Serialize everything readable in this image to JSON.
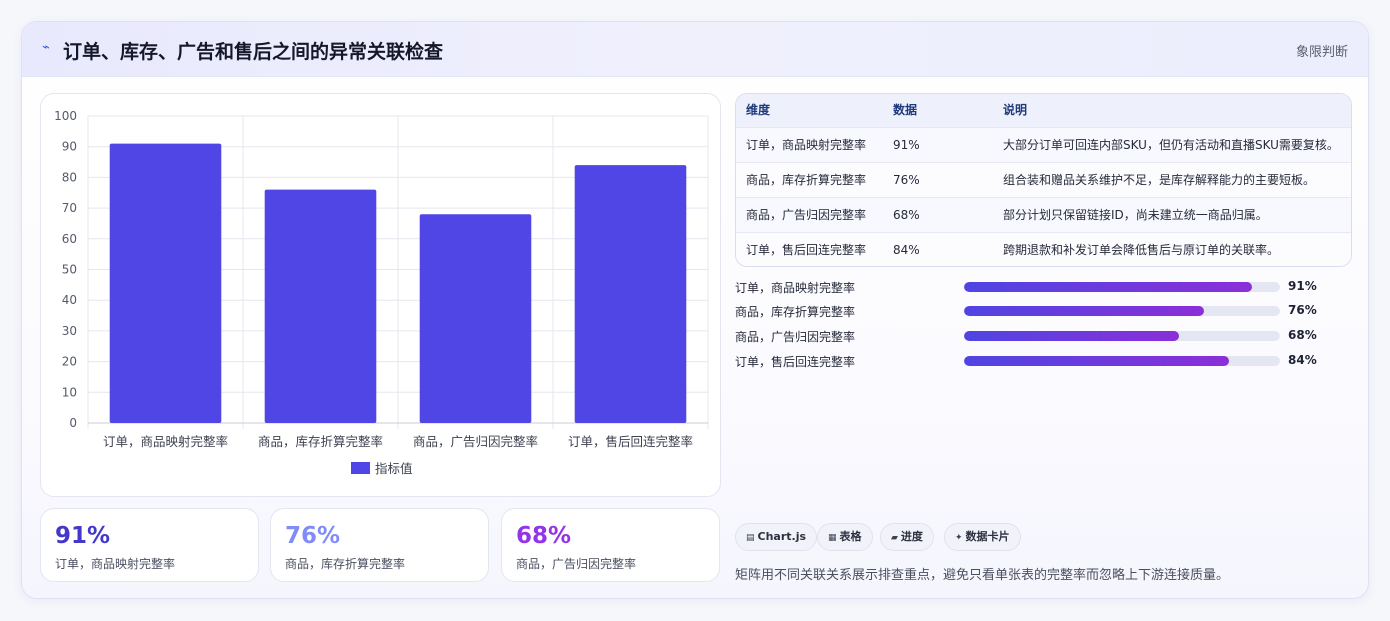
{
  "header": {
    "icon": "pulse-icon",
    "title": "订单、库存、广告和售后之间的异常关联检查",
    "tag": "象限判断"
  },
  "chart_data": {
    "type": "bar",
    "categories": [
      "订单，商品映射完整率",
      "商品，库存折算完整率",
      "商品，广告归因完整率",
      "订单，售后回连完整率"
    ],
    "series": [
      {
        "name": "指标值",
        "values": [
          91,
          76,
          68,
          84
        ],
        "color": "#5046e5"
      }
    ],
    "ylim": [
      0,
      100
    ],
    "yticks": [
      0,
      10,
      20,
      30,
      40,
      50,
      60,
      70,
      80,
      90,
      100
    ],
    "grid": true,
    "legend": "bottom"
  },
  "kpis": [
    {
      "value": "91%",
      "label": "订单，商品映射完整率",
      "color": "#4338ca"
    },
    {
      "value": "76%",
      "label": "商品，库存折算完整率",
      "color": "#818cf8"
    },
    {
      "value": "68%",
      "label": "商品，广告归因完整率",
      "color": "#9333ea"
    }
  ],
  "table": {
    "headers": [
      "维度",
      "数据",
      "说明"
    ],
    "rows": [
      [
        "订单，商品映射完整率",
        "91%",
        "大部分订单可回连内部SKU，但仍有活动和直播SKU需要复核。"
      ],
      [
        "商品，库存折算完整率",
        "76%",
        "组合装和赠品关系维护不足，是库存解释能力的主要短板。"
      ],
      [
        "商品，广告归因完整率",
        "68%",
        "部分计划只保留链接ID，尚未建立统一商品归属。"
      ],
      [
        "订单，售后回连完整率",
        "84%",
        "跨期退款和补发订单会降低售后与原订单的关联率。"
      ]
    ]
  },
  "progress": [
    {
      "label": "订单，商品映射完整率",
      "value": 91,
      "text": "91%"
    },
    {
      "label": "商品，库存折算完整率",
      "value": 76,
      "text": "76%"
    },
    {
      "label": "商品，广告归因完整率",
      "value": 68,
      "text": "68%"
    },
    {
      "label": "订单，售后回连完整率",
      "value": 84,
      "text": "84%"
    }
  ],
  "chips": [
    {
      "icon": "chart-icon",
      "glyph": "▤",
      "label": "Chart.js"
    },
    {
      "icon": "table-icon",
      "glyph": "▦",
      "label": "表格"
    },
    {
      "icon": "progress-icon",
      "glyph": "▰",
      "label": "进度"
    },
    {
      "icon": "sparkle-icon",
      "glyph": "✦",
      "label": "数据卡片"
    }
  ],
  "note": "矩阵用不同关联关系展示排查重点，避免只看单张表的完整率而忽略上下游连接质量。"
}
